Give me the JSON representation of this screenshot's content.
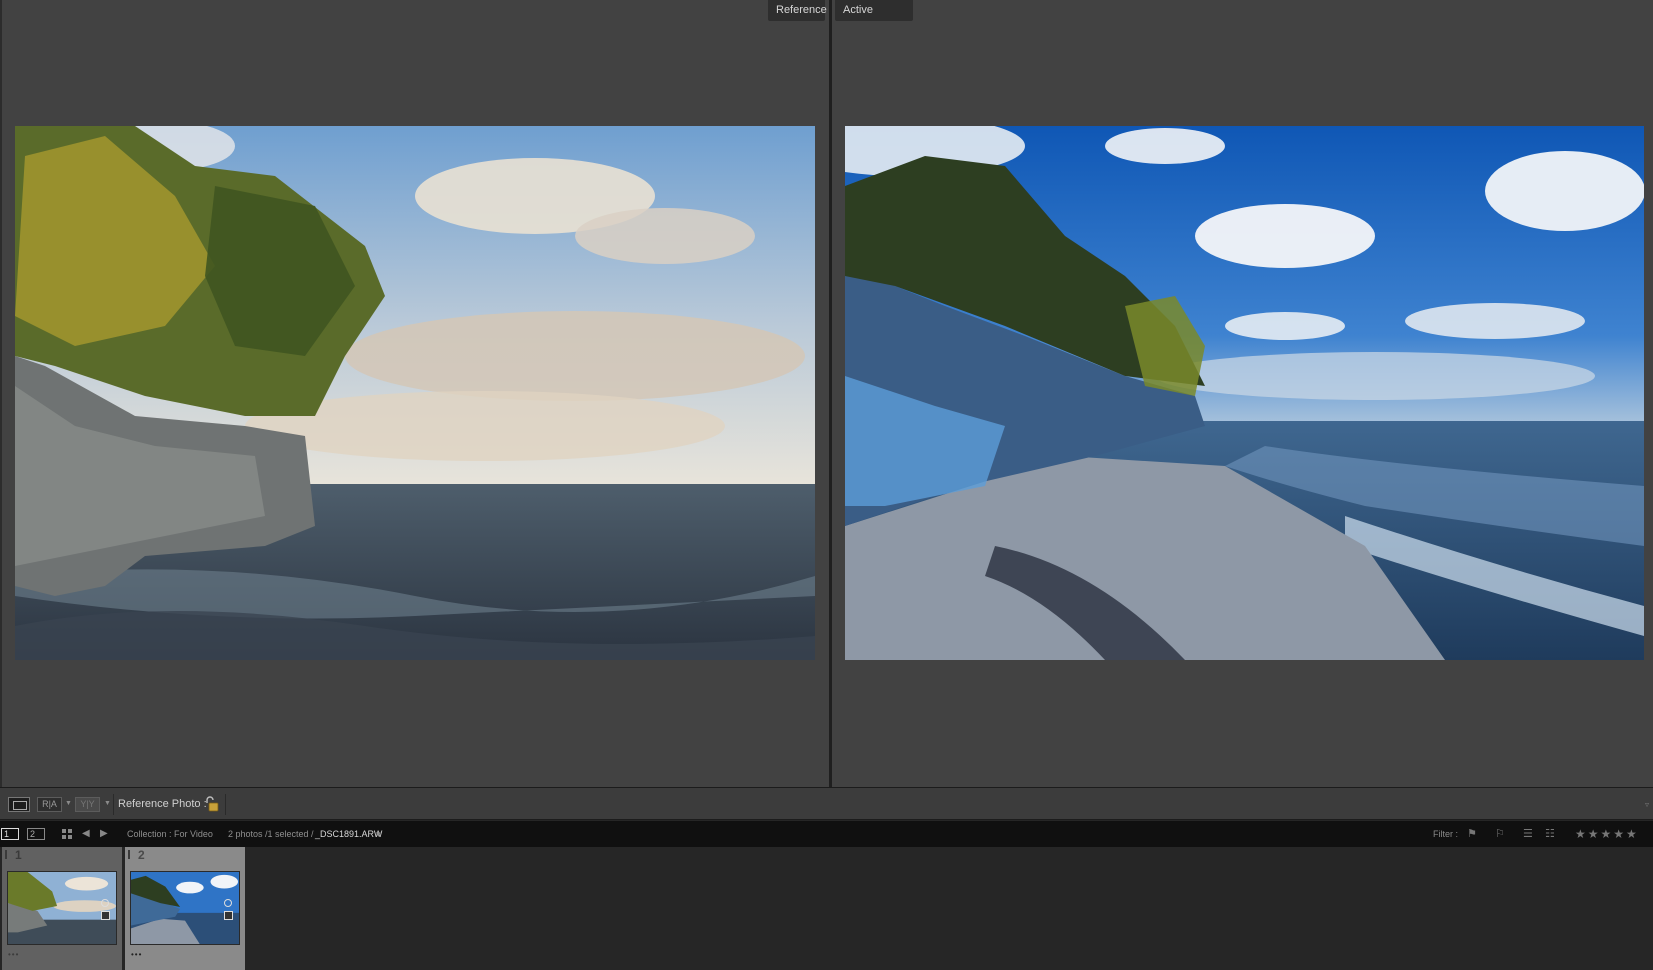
{
  "compare": {
    "reference_label": "Reference",
    "active_label": "Active"
  },
  "photos": {
    "reference": {
      "description_icon": "photo-shoreline-warm"
    },
    "active": {
      "description_icon": "photo-shoreline-blue"
    }
  },
  "toolbar": {
    "view_ra": "R|A",
    "view_yy": "Y|Y",
    "reference_photo_label": "Reference Photo :",
    "lock_icon": "unlocked-padlock-icon",
    "expand_caret": "▿"
  },
  "filmbar": {
    "screen_one": "1",
    "screen_two": "2",
    "collection": "Collection : For Video",
    "selection_info": "2 photos /1 selected /",
    "filename": "_DSC1891.ARW",
    "filename_caret": "▾",
    "filter_label": "Filter :",
    "stars": "★★★★★"
  },
  "filmstrip": {
    "items": [
      {
        "number": "1",
        "dots": "•••"
      },
      {
        "number": "2",
        "dots": "•••"
      }
    ]
  },
  "colors": {
    "panel_bg": "#424242",
    "toolbar_bg": "#3c3c3c",
    "filmbar_bg": "#101010",
    "selected_cell": "#8a8a8a"
  }
}
